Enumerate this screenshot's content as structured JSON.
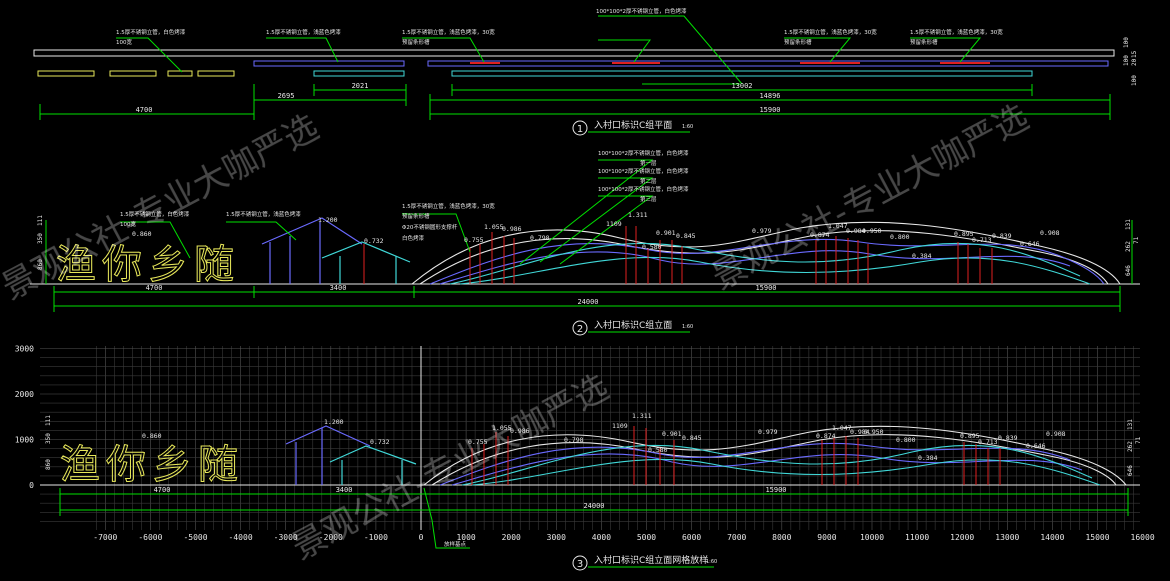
{
  "titles": {
    "plan": {
      "num": "1",
      "text": "入村口标识C组平面",
      "scale": "1:60"
    },
    "elevation": {
      "num": "2",
      "text": "入村口标识C组立面",
      "scale": "1:60"
    },
    "grid": {
      "num": "3",
      "text": "入村口标识C组立面网格放样",
      "scale": "1:60"
    }
  },
  "plan": {
    "notes": {
      "n1a": "1.5厚不锈钢立管，白色烤漆",
      "n1b": "100宽",
      "n2": "1.5厚不锈钢立管，浅蓝色烤漆",
      "n3a": "1.5厚不锈钢立管，浅蓝色烤漆，30宽",
      "n3b": "预留条形槽",
      "top": "100*100*2厚不锈钢立管，白色烤漆",
      "n4a": "1.5厚不锈钢立管，浅蓝色烤漆，30宽",
      "n4b": "预留条形槽",
      "n5a": "1.5厚不锈钢立管，浅蓝色烤漆，30宽",
      "n5b": "预留条形槽"
    },
    "dims": {
      "d4700": "4700",
      "d2695": "2695",
      "d2021": "2021",
      "d13002": "13002",
      "d14896": "14896",
      "d15900": "15900"
    },
    "right": {
      "r100a": "100",
      "r100b": "100",
      "r15": "15",
      "r20": "20",
      "r100c": "100"
    }
  },
  "elevation": {
    "sign_text": "渔你乡随",
    "notes": {
      "w1a": "1.5厚不锈钢立管，白色烤漆",
      "w1b": "100宽",
      "w2": "1.5厚不锈钢立管，浅蓝色烤漆",
      "w3a": "1.5厚不锈钢立管，浅蓝色烤漆，30宽",
      "w3b": "预留条形槽",
      "w3c": "Φ20不锈钢圆形支撑杆",
      "w3d": "白色烤漆",
      "top1a": "100*100*2厚不锈钢立管，白色烤漆",
      "top1b": "第一层",
      "top2a": "100*100*2厚不锈钢立管，白色烤漆",
      "top2b": "第二层",
      "top3a": "100*100*2厚不锈钢立管，白色烤漆",
      "top3b": "第三层"
    },
    "heights": {
      "h0860": "0.860",
      "h1200": "1.200",
      "h0732": "0.732",
      "h0755": "0.755",
      "h1055": "1.055",
      "h0986": "0.986",
      "h0798": "0.798",
      "h1109": "1109",
      "h1311": "1.311",
      "h0580": "0.580",
      "h0901": "0.901",
      "h0845": "0.845",
      "h0979": "0.979",
      "h0874": "0.874",
      "h1047": "1.047",
      "h0984": "0.984",
      "h0950": "0.950",
      "h0800": "0.800",
      "h0384": "0.384",
      "h0895": "0.895",
      "h0713": "0.713",
      "h0839": "0.839",
      "h0646": "0.646",
      "h0908": "0.908"
    },
    "dims": {
      "d4700": "4700",
      "d3400": "3400",
      "d15900": "15900",
      "d24000": "24000"
    },
    "left": {
      "l111": "111",
      "l350": "350",
      "l860": "860"
    },
    "right": {
      "r131": "131",
      "r71": "71",
      "r646": "646",
      "r262": "262"
    }
  },
  "grid": {
    "y_ticks": [
      "0",
      "1000",
      "2000",
      "3000"
    ],
    "x_ticks": [
      "-7000",
      "-6000",
      "-5000",
      "-4000",
      "-3000",
      "-2000",
      "-1000",
      "0",
      "1000",
      "2000",
      "3000",
      "4000",
      "5000",
      "6000",
      "7000",
      "8000",
      "9000",
      "10000",
      "11000",
      "12000",
      "13000",
      "14000",
      "15000",
      "16000"
    ],
    "dims": {
      "d4700": "4700",
      "d3400": "3400",
      "d15900": "15900",
      "d24000": "24000"
    },
    "note": "放样基点"
  },
  "watermark": "景观公社-专业大咖严选",
  "colors": {
    "green": "#00e000",
    "white": "#e8e8e8",
    "yellow": "#e8e85a",
    "blue": "#6a6aff",
    "cyan": "#40d8d8",
    "red": "#e02020",
    "grid": "#3a3a3a"
  }
}
